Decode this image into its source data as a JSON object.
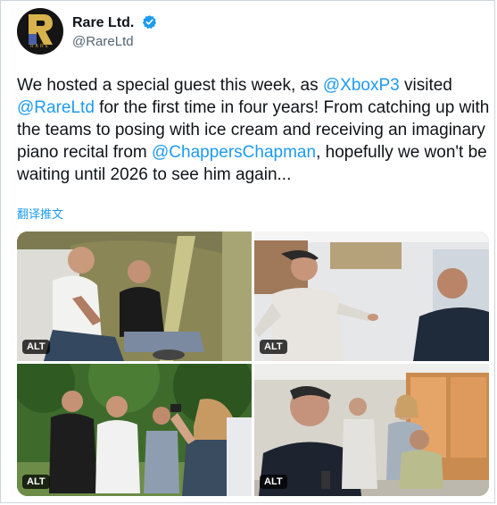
{
  "account": {
    "display_name": "Rare Ltd.",
    "handle": "@RareLtd",
    "avatar_letter": "R",
    "avatar_text": "RARE",
    "verified": true
  },
  "tweet": {
    "segments": [
      {
        "text": "We hosted a special guest this week, as ",
        "type": "text"
      },
      {
        "text": "@XboxP3",
        "type": "mention"
      },
      {
        "text": " visited ",
        "type": "text"
      },
      {
        "text": "@RareLtd",
        "type": "mention"
      },
      {
        "text": " for the first time in four years! From catching up with the teams to posing with ice cream and receiving an imaginary piano recital from ",
        "type": "text"
      },
      {
        "text": "@ChappersChapman",
        "type": "mention"
      },
      {
        "text": ", hopefully we won't be waiting until 2026 to see him again...",
        "type": "text"
      }
    ],
    "translate_label": "翻译推文"
  },
  "media": [
    {
      "alt_label": "ALT"
    },
    {
      "alt_label": "ALT"
    },
    {
      "alt_label": "ALT"
    },
    {
      "alt_label": "ALT"
    }
  ],
  "colors": {
    "accent": "#1d9bf0",
    "text": "#0f1419",
    "secondary_text": "#536471"
  }
}
